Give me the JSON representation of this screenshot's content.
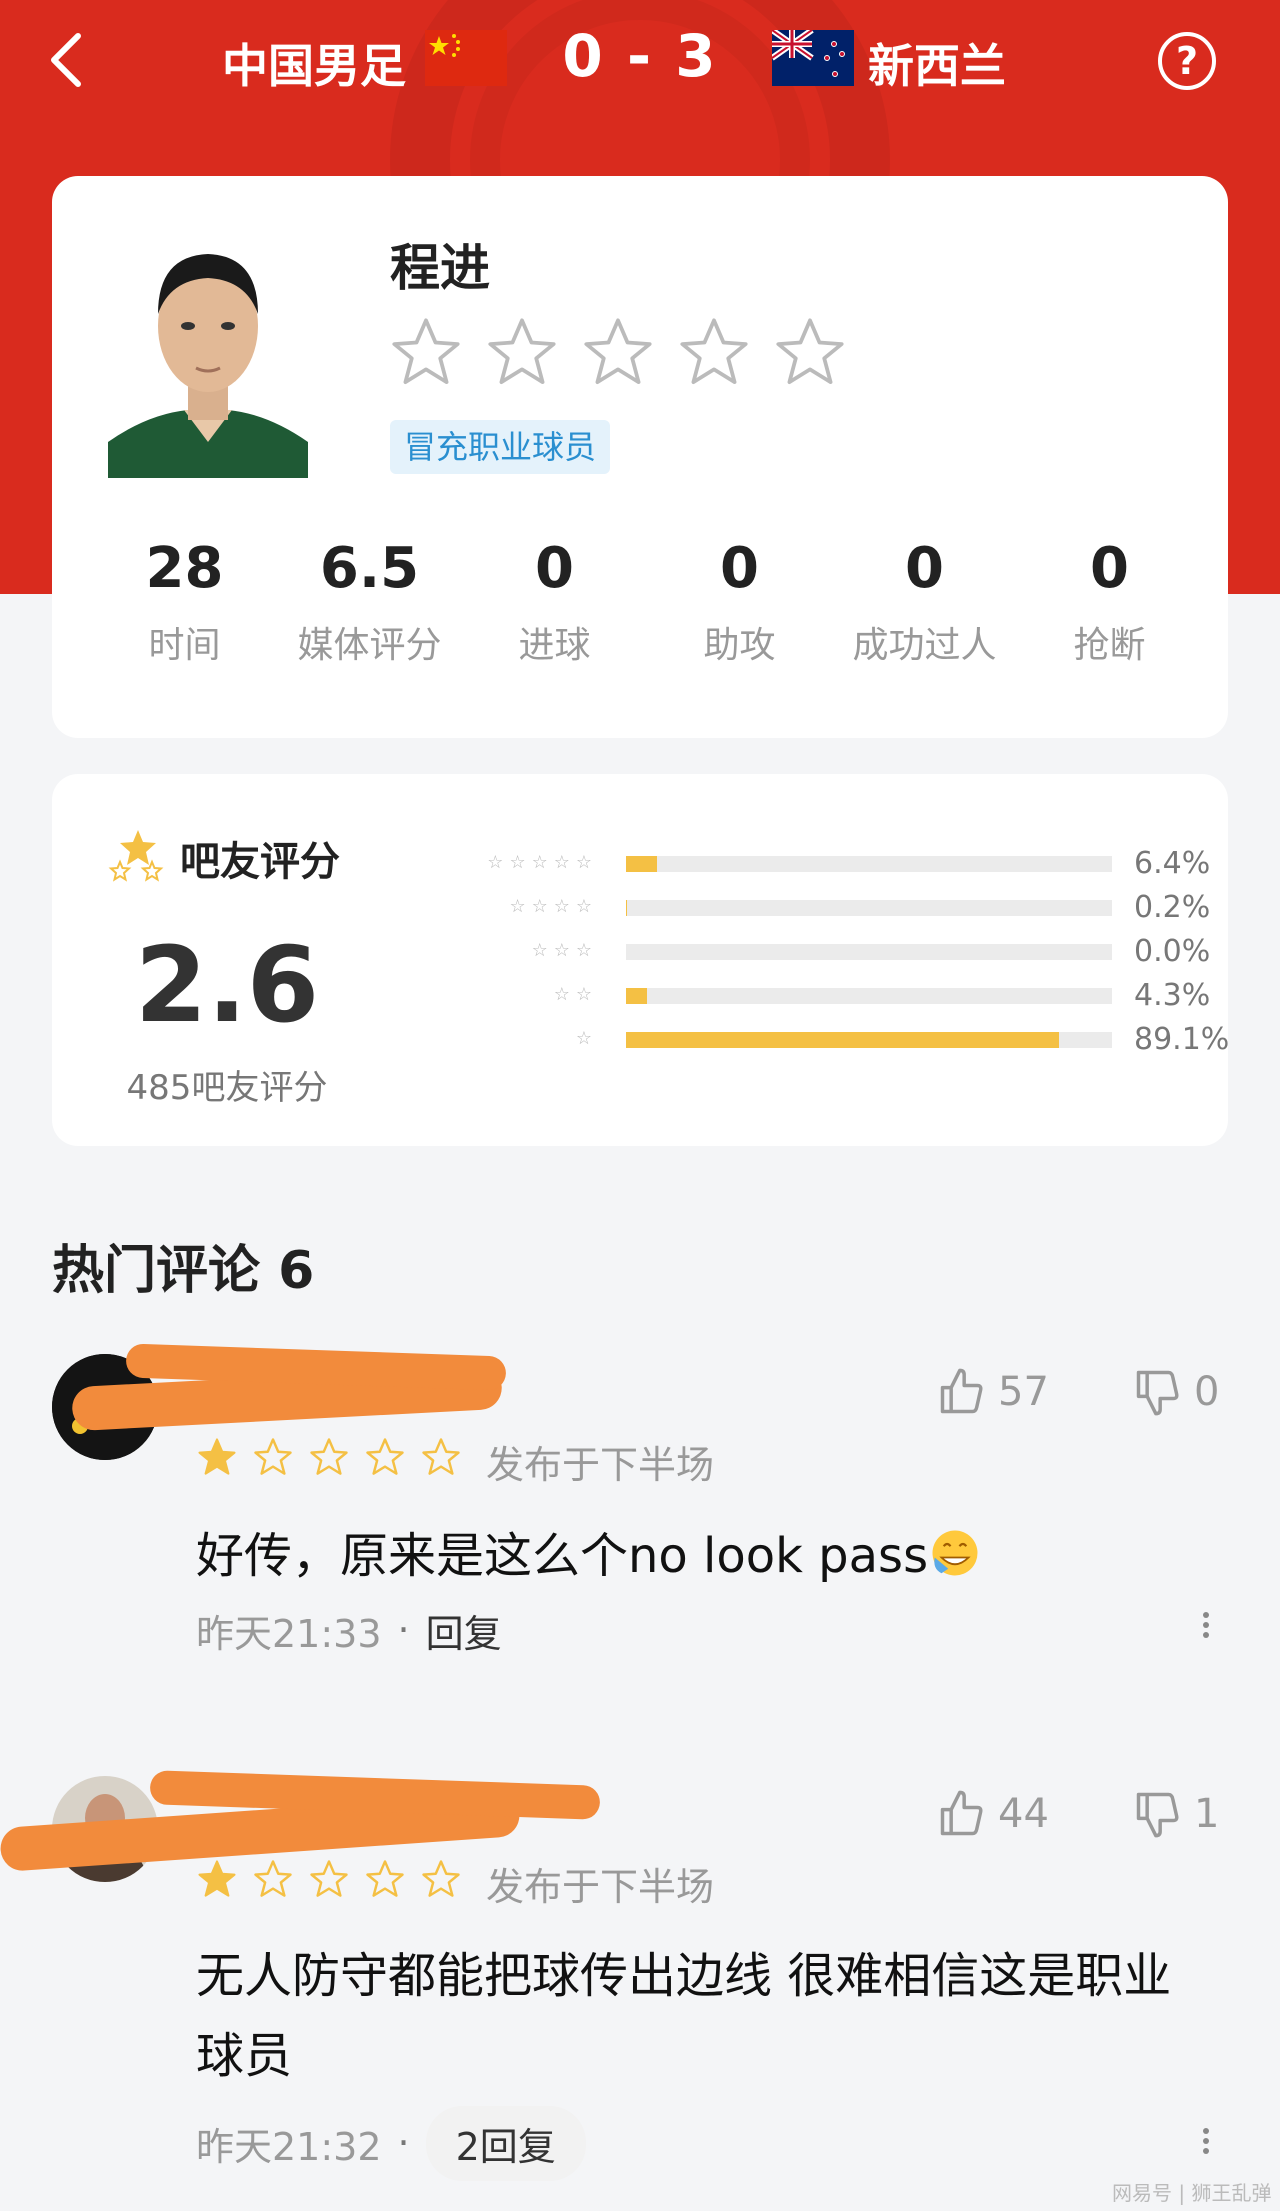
{
  "match": {
    "home_team": "中国男足",
    "score": "0 - 3",
    "away_team": "新西兰"
  },
  "player": {
    "name": "程进",
    "tag": "冒充职业球员",
    "stats": [
      {
        "value": "28",
        "label": "时间"
      },
      {
        "value": "6.5",
        "label": "媒体评分"
      },
      {
        "value": "0",
        "label": "进球"
      },
      {
        "value": "0",
        "label": "助攻"
      },
      {
        "value": "0",
        "label": "成功过人"
      },
      {
        "value": "0",
        "label": "抢断"
      }
    ]
  },
  "fan_rating": {
    "title": "吧友评分",
    "score": "2.6",
    "count_text": "485吧友评分",
    "distribution": [
      {
        "stars": 5,
        "percent": 6.4,
        "label": "6.4%"
      },
      {
        "stars": 4,
        "percent": 0.2,
        "label": "0.2%"
      },
      {
        "stars": 3,
        "percent": 0.0,
        "label": "0.0%"
      },
      {
        "stars": 2,
        "percent": 4.3,
        "label": "4.3%"
      },
      {
        "stars": 1,
        "percent": 89.1,
        "label": "89.1%"
      }
    ]
  },
  "hot_comments": {
    "title": "热门评论 6"
  },
  "comments": [
    {
      "stars": 1,
      "likes": "57",
      "dislikes": "0",
      "period": "发布于下半场",
      "text": "好传，原来是这么个no look pass",
      "time": "昨天21:33",
      "reply_label": "回复"
    },
    {
      "stars": 1,
      "likes": "44",
      "dislikes": "1",
      "period": "发布于下半场",
      "text": "无人防守都能把球传出边线 很难相信这是职业球员",
      "time": "昨天21:32",
      "reply_label": "2回复"
    }
  ],
  "footer": {
    "watermark": "网易号 | 狮王乱弹"
  },
  "colors": {
    "header_red": "#d92b1e",
    "star_gold": "#f4c044",
    "tag_blue": "#2a8fd0"
  },
  "icons": [
    "back-icon",
    "help-icon",
    "star-icon",
    "thumbs-up-icon",
    "thumbs-down-icon",
    "more-icon",
    "grinning-emoji-icon"
  ]
}
